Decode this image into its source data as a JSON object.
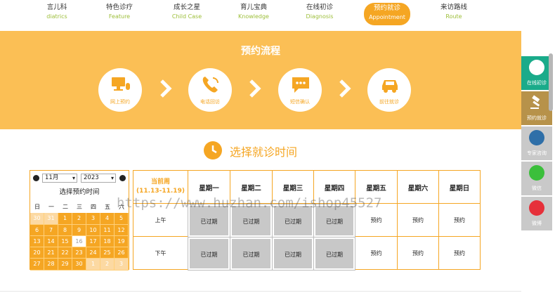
{
  "nav": {
    "items": [
      {
        "zh": "言儿科",
        "en": "diatrics"
      },
      {
        "zh": "特色诊疗",
        "en": "Feature"
      },
      {
        "zh": "成长之星",
        "en": "Child Case"
      },
      {
        "zh": "育儿宝典",
        "en": "Knowledge"
      },
      {
        "zh": "在线初诊",
        "en": "Diagnosis"
      },
      {
        "zh": "预约就诊",
        "en": "Appointment"
      },
      {
        "zh": "来访路线",
        "en": "Route"
      }
    ],
    "active_index": 5
  },
  "banner": {
    "title": "预约流程",
    "steps": [
      {
        "label": "网上预约",
        "icon": "computer-mouse-icon"
      },
      {
        "label": "电话回访",
        "icon": "phone-icon"
      },
      {
        "label": "短信确认",
        "icon": "message-icon"
      },
      {
        "label": "前往就诊",
        "icon": "car-icon"
      }
    ]
  },
  "sidebar": {
    "items": [
      {
        "label": "在线初诊",
        "icon": "stethoscope-icon",
        "color": "#1aab8a"
      },
      {
        "label": "预约就诊",
        "icon": "gavel-icon",
        "color": "#b7924a"
      },
      {
        "label": "专家咨询",
        "icon": "people-icon",
        "color": "#c9c9c9"
      },
      {
        "label": "微信",
        "icon": "wechat-icon",
        "color": "#c9c9c9"
      },
      {
        "label": "微博",
        "icon": "weibo-icon",
        "color": "#c9c9c9"
      }
    ]
  },
  "section": {
    "title": "选择就诊时间"
  },
  "calendar": {
    "month": "11月",
    "year": "2023",
    "caption": "选择预约时间",
    "weekdays": [
      "日",
      "一",
      "二",
      "三",
      "四",
      "五",
      "六"
    ],
    "weeks": [
      [
        "30",
        "31",
        "1",
        "2",
        "3",
        "4",
        "5"
      ],
      [
        "6",
        "7",
        "8",
        "9",
        "10",
        "11",
        "12"
      ],
      [
        "13",
        "14",
        "15",
        "16",
        "17",
        "18",
        "19"
      ],
      [
        "20",
        "21",
        "22",
        "23",
        "24",
        "25",
        "26"
      ],
      [
        "27",
        "28",
        "29",
        "30",
        "1",
        "2",
        "3"
      ]
    ]
  },
  "schedule": {
    "current_week_label": "当前周",
    "current_week_range": "(11.13-11.19)",
    "days": [
      "星期一",
      "星期二",
      "星期三",
      "星期四",
      "星期五",
      "星期六",
      "星期日"
    ],
    "periods": [
      "上午",
      "下午"
    ],
    "slots": {
      "am": [
        "已过期",
        "已过期",
        "已过期",
        "已过期",
        "预约",
        "预约",
        "预约"
      ],
      "pm": [
        "已过期",
        "已过期",
        "已过期",
        "已过期",
        "预约",
        "预约",
        "预约"
      ]
    }
  },
  "watermark": "https://www.huzhan.com/ishop45527",
  "colors": {
    "accent": "#f5a623",
    "banner": "#fbbf55",
    "past": "#c8c8c8",
    "nav_en": "#9dbf3a"
  }
}
